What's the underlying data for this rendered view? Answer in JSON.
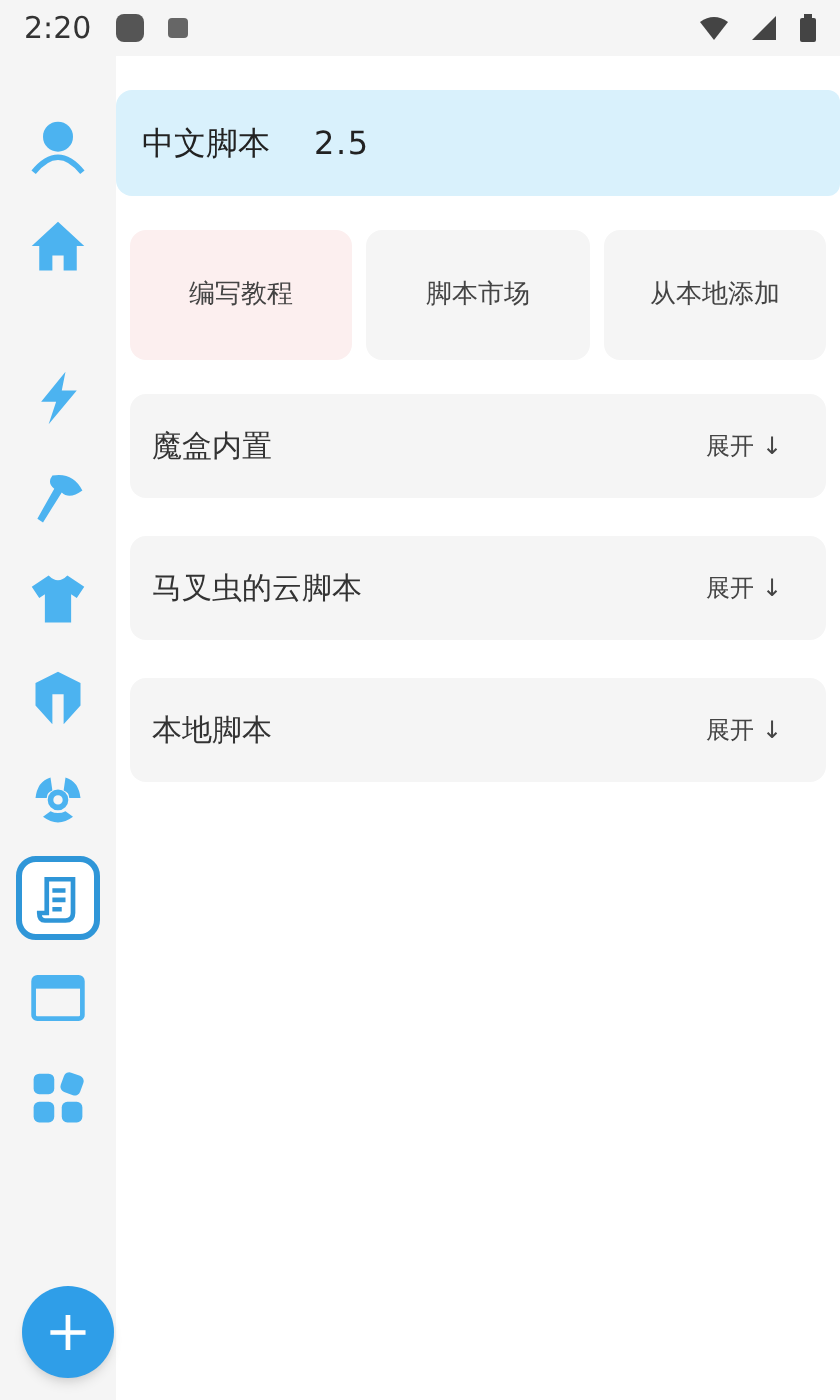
{
  "status_bar": {
    "time": "2:20"
  },
  "sidebar": {
    "items": [
      {
        "kind": "person",
        "selected": false
      },
      {
        "kind": "home",
        "selected": false
      },
      {
        "kind": "bolt",
        "selected": false
      },
      {
        "kind": "axe",
        "selected": false
      },
      {
        "kind": "shirt",
        "selected": false
      },
      {
        "kind": "helmet",
        "selected": false
      },
      {
        "kind": "radiation",
        "selected": false
      },
      {
        "kind": "scroll",
        "selected": true
      },
      {
        "kind": "window",
        "selected": false
      },
      {
        "kind": "apps",
        "selected": false
      }
    ]
  },
  "header": {
    "title": "中文脚本",
    "version": "2.5"
  },
  "actions": [
    {
      "label": "编写教程",
      "color": "#fcefef"
    },
    {
      "label": "脚本市场",
      "color": "#f5f5f5"
    },
    {
      "label": "从本地添加",
      "color": "#f5f5f5"
    }
  ],
  "sections": [
    {
      "title": "魔盒内置",
      "toggle": "展开 ↓"
    },
    {
      "title": "马叉虫的云脚本",
      "toggle": "展开 ↓"
    },
    {
      "title": "本地脚本",
      "toggle": "展开 ↓"
    }
  ],
  "fab": {
    "label": "+"
  }
}
